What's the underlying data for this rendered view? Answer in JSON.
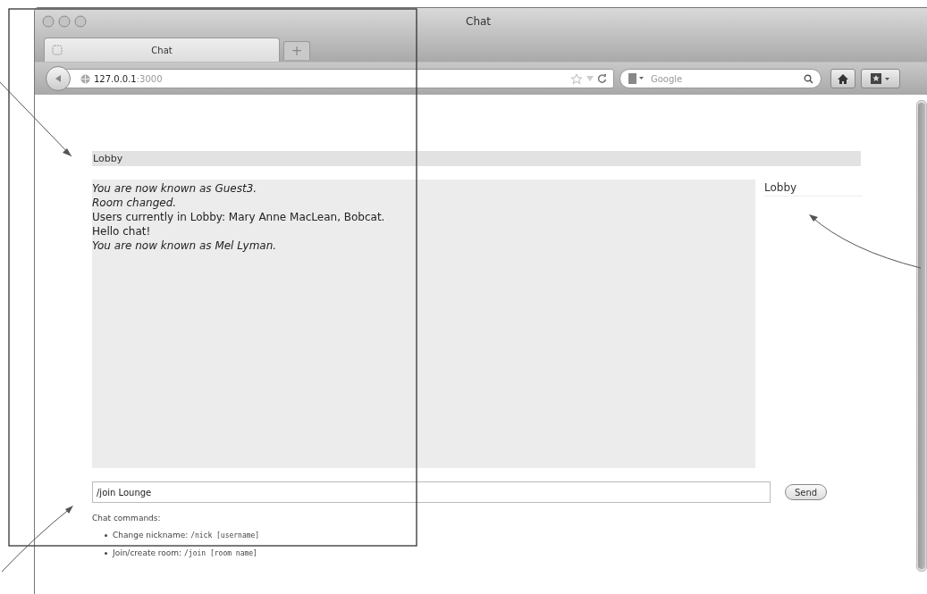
{
  "window": {
    "title": "Chat"
  },
  "tabs": [
    {
      "label": "Chat",
      "selected": true
    }
  ],
  "new_tab": "+",
  "address_bar": {
    "host": "127.0.0.1",
    "port": ":3000"
  },
  "search": {
    "placeholder": "Google"
  },
  "page": {
    "room_title": "Lobby",
    "messages": [
      {
        "kind": "system",
        "text": "You are now known as Guest3."
      },
      {
        "kind": "system",
        "text": "Room changed."
      },
      {
        "kind": "message",
        "text": "Users currently in Lobby: Mary Anne MacLean, Bobcat."
      },
      {
        "kind": "message",
        "text": "Hello chat!"
      },
      {
        "kind": "system",
        "text": "You are now known as Mel Lyman."
      }
    ],
    "rooms": [
      {
        "name": "Lobby"
      }
    ],
    "input": {
      "value": "/join Lounge"
    },
    "send_button": "Send",
    "help_title": "Chat commands:",
    "commands": [
      {
        "label": "Change nickname:",
        "command": "/nick [username]"
      },
      {
        "label": "Join/create room:",
        "command": "/join [room name]"
      }
    ]
  }
}
